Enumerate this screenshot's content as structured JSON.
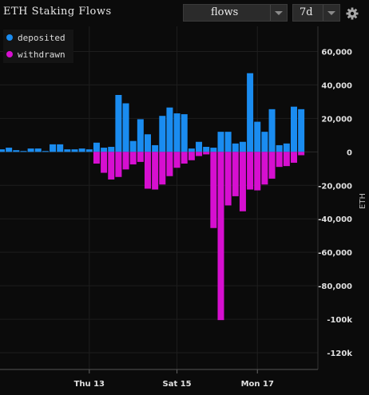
{
  "title": "ETH Staking Flows",
  "controls": {
    "mode_value": "flows",
    "range_value": "7d"
  },
  "icons": {
    "settings": "gear-icon",
    "dropdown": "chevron-down-icon"
  },
  "colors": {
    "background": "#0b0b0b",
    "deposited": "#1a8cf0",
    "withdrawn": "#d60fd0",
    "grid": "#1e1e1e",
    "axis_text": "#e0e0e0"
  },
  "chart_data": {
    "type": "bar",
    "ylabel": "ETH",
    "ylim": [
      -130000,
      75000
    ],
    "yticks": [
      60000,
      40000,
      20000,
      0,
      -20000,
      -40000,
      -60000,
      -80000,
      -100000,
      -120000
    ],
    "ytick_labels": [
      "60,000",
      "40,000",
      "20,000",
      "0",
      "-20,000",
      "-40,000",
      "-60,000",
      "-80,000",
      "-100k",
      "-120k"
    ],
    "x_tick_labels": [
      {
        "label": "Thu 13",
        "index": 12
      },
      {
        "label": "Sat 15",
        "index": 24
      },
      {
        "label": "Mon 17",
        "index": 35
      }
    ],
    "legend_position": "top-left",
    "series": [
      {
        "name": "deposited",
        "values": [
          1500,
          2500,
          1000,
          500,
          2000,
          2000,
          500,
          4500,
          4500,
          1500,
          1500,
          2000,
          1500,
          5500,
          2500,
          3000,
          34000,
          29000,
          6500,
          19500,
          10500,
          4000,
          21500,
          26500,
          23000,
          22500,
          2000,
          6000,
          3000,
          2500,
          12000,
          12000,
          5000,
          6000,
          47000,
          18000,
          12000,
          25500,
          4000,
          5000,
          27000,
          25500
        ]
      },
      {
        "name": "withdrawn",
        "values": [
          0,
          0,
          0,
          0,
          0,
          0,
          0,
          0,
          0,
          0,
          0,
          0,
          0,
          -7000,
          -12500,
          -16500,
          -15000,
          -10500,
          -7500,
          -6000,
          -22000,
          -22500,
          -19500,
          -14500,
          -9500,
          -7000,
          -5000,
          -2500,
          -1500,
          -45500,
          -100500,
          -32000,
          -26500,
          -35500,
          -22500,
          -23000,
          -19500,
          -16000,
          -9000,
          -8500,
          -6500,
          -2000
        ]
      }
    ]
  }
}
